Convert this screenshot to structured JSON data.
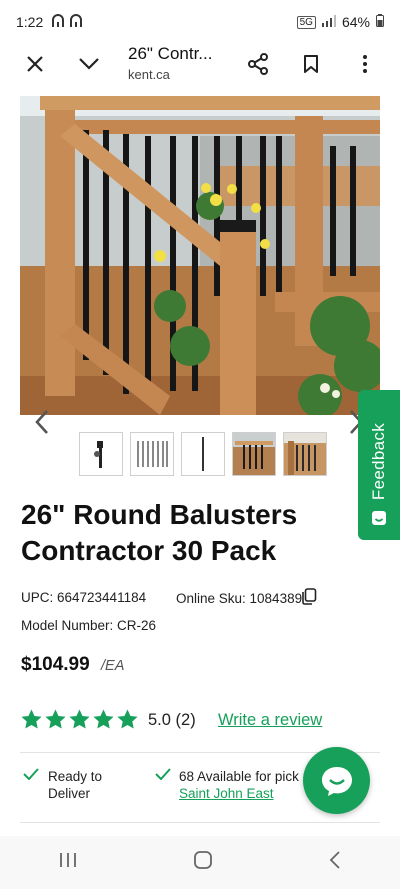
{
  "status_bar": {
    "time": "1:22",
    "battery": "64%",
    "network": "5G"
  },
  "browser": {
    "page_title": "26\" Contr...",
    "domain": "kent.ca"
  },
  "product": {
    "title": "26\" Round Balusters Contractor 30 Pack",
    "upc_label": "UPC: 664723441184",
    "online_sku_label": "Online Sku: 1084389",
    "model_label": "Model Number: CR-26",
    "price": "$104.99",
    "price_unit": "/EA",
    "rating_value": 5.0,
    "rating_text": "5.0 (2)",
    "write_review": "Write a review",
    "thumbnail_count": 5
  },
  "availability": {
    "deliver_text": "Ready to Deliver",
    "pickup_text": "68 Available for pick",
    "store_link": "Saint John East"
  },
  "feedback_tab": {
    "label": "Feedback"
  },
  "colors": {
    "brand_green": "#16a05a",
    "text": "#111111",
    "divider": "#e2e2e2"
  }
}
